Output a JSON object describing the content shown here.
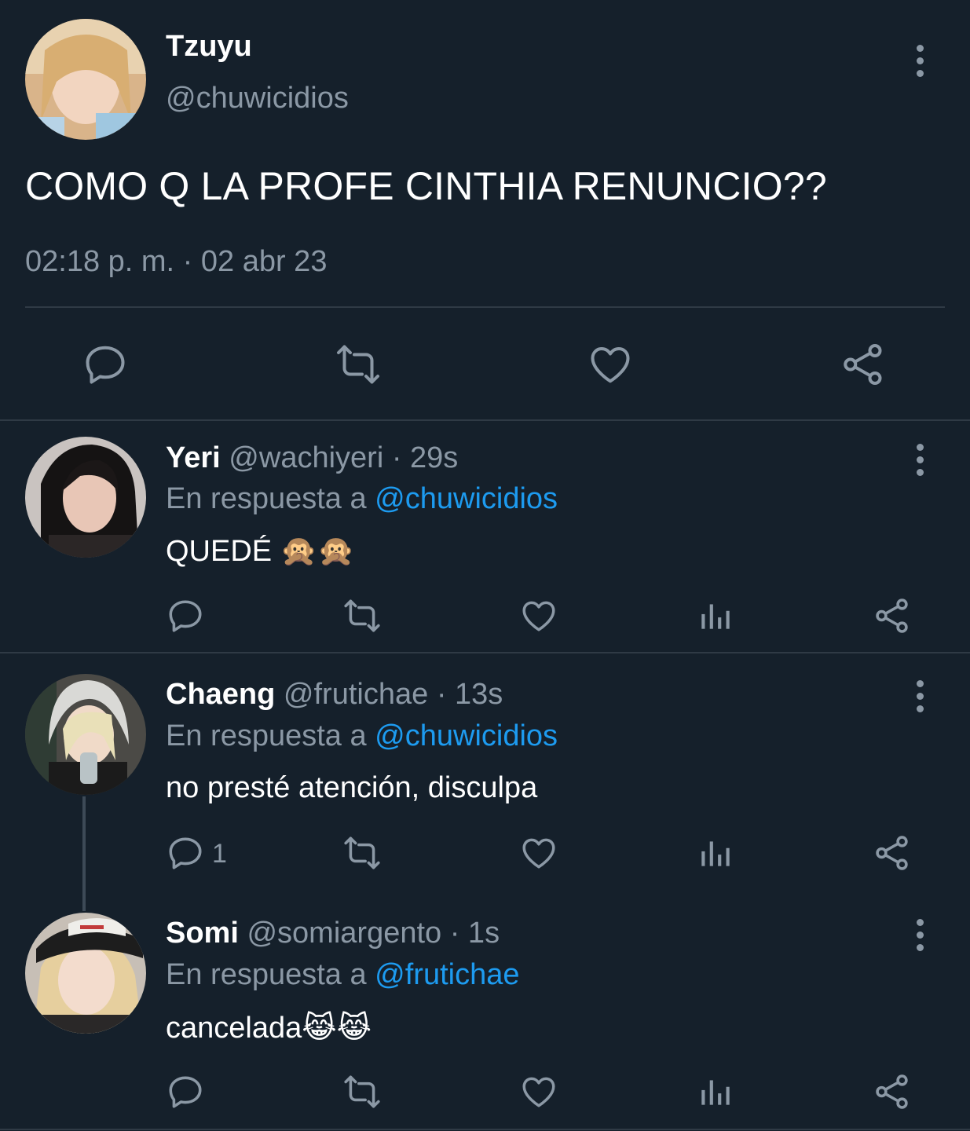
{
  "main_tweet": {
    "name": "Tzuyu",
    "handle": "@chuwicidios",
    "text": "COMO Q LA PROFE CINTHIA RENUNCIO??",
    "timestamp": "02:18 p. m. · 02 abr 23",
    "actions": [
      "reply-icon",
      "retweet-icon",
      "like-icon",
      "share-icon"
    ]
  },
  "replies": [
    {
      "name": "Yeri",
      "handle": "@wachiyeri",
      "time": "· 29s",
      "reply_prefix": "En respuesta a",
      "reply_to": "@chuwicidios",
      "text": "QUEDÉ 🙊🙊",
      "reply_count": ""
    },
    {
      "name": "Chaeng",
      "handle": "@frutichae",
      "time": "· 13s",
      "reply_prefix": "En respuesta a",
      "reply_to": "@chuwicidios",
      "text": "no presté atención, disculpa",
      "reply_count": "1"
    },
    {
      "name": "Somi",
      "handle": "@somiargento",
      "time": "· 1s",
      "reply_prefix": "En respuesta a",
      "reply_to": "@frutichae",
      "text": "cancelada😹😹",
      "reply_count": ""
    }
  ],
  "colors": {
    "background": "#15202b",
    "muted": "#8b98a5",
    "link": "#1d9bf0",
    "divider": "#2f3a45"
  }
}
